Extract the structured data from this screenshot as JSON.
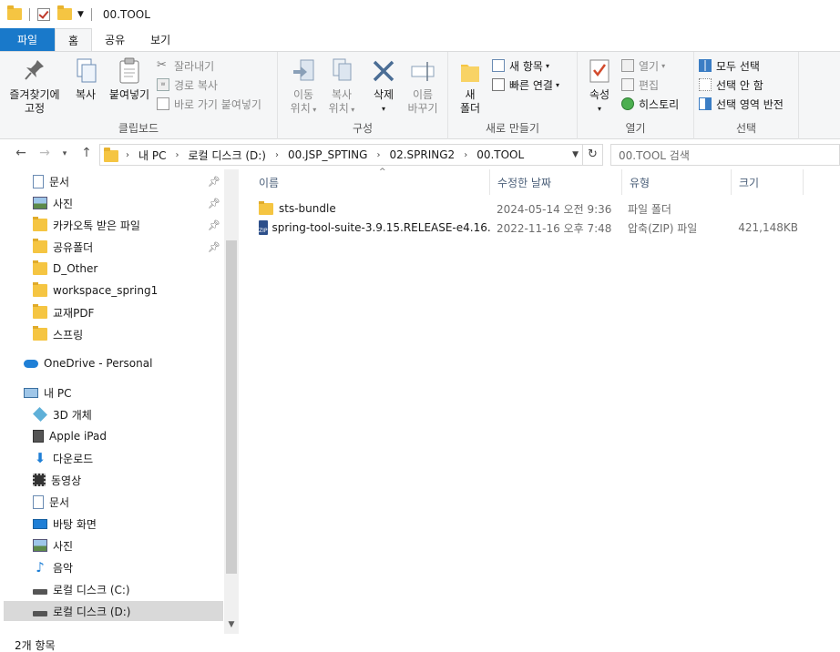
{
  "window": {
    "title": "00.TOOL"
  },
  "ribbon_tabs": [
    {
      "label": "파일"
    },
    {
      "label": "홈"
    },
    {
      "label": "공유"
    },
    {
      "label": "보기"
    }
  ],
  "ribbon": {
    "clipboard": {
      "pin_label_1": "즐겨찾기에",
      "pin_label_2": "고정",
      "copy": "복사",
      "paste": "붙여넣기",
      "cut": "잘라내기",
      "copy_path": "경로 복사",
      "paste_shortcut": "바로 가기 붙여넣기",
      "group": "클립보드"
    },
    "organize": {
      "move_1": "이동",
      "move_2": "위치",
      "copy_1": "복사",
      "copy_2": "위치",
      "delete": "삭제",
      "rename_1": "이름",
      "rename_2": "바꾸기",
      "group": "구성"
    },
    "new": {
      "new_folder_1": "새",
      "new_folder_2": "폴더",
      "new_item": "새 항목",
      "easy_access": "빠른 연결",
      "group": "새로 만들기"
    },
    "open": {
      "properties": "속성",
      "open": "열기",
      "edit": "편집",
      "history": "히스토리",
      "group": "열기"
    },
    "select": {
      "select_all": "모두 선택",
      "select_none": "선택 안 함",
      "invert": "선택 영역 반전",
      "group": "선택"
    }
  },
  "address": {
    "segments": [
      "내 PC",
      "로컬 디스크 (D:)",
      "00.JSP_SPTING",
      "02.SPRING2",
      "00.TOOL"
    ],
    "search_placeholder": "00.TOOL 검색"
  },
  "sidebar": {
    "quick_access": [
      {
        "label": "문서",
        "icon": "document-icon",
        "pinned": true
      },
      {
        "label": "사진",
        "icon": "pictures-icon",
        "pinned": true
      },
      {
        "label": "카카오톡 받은 파일",
        "icon": "folder-icon",
        "pinned": true
      },
      {
        "label": "공유폴더",
        "icon": "shared-folder-icon",
        "pinned": true
      },
      {
        "label": "D_Other",
        "icon": "folder-icon",
        "pinned": false
      },
      {
        "label": "workspace_spring1",
        "icon": "folder-icon",
        "pinned": false
      },
      {
        "label": "교재PDF",
        "icon": "folder-icon",
        "pinned": false
      },
      {
        "label": "스프링",
        "icon": "folder-icon",
        "pinned": false
      }
    ],
    "onedrive": "OneDrive - Personal",
    "this_pc": "내 PC",
    "pc_items": [
      {
        "label": "3D 개체",
        "icon": "3d-objects-icon"
      },
      {
        "label": "Apple iPad",
        "icon": "ipad-icon"
      },
      {
        "label": "다운로드",
        "icon": "download-icon"
      },
      {
        "label": "동영상",
        "icon": "video-icon"
      },
      {
        "label": "문서",
        "icon": "document-icon"
      },
      {
        "label": "바탕 화면",
        "icon": "desktop-icon"
      },
      {
        "label": "사진",
        "icon": "pictures-icon"
      },
      {
        "label": "음악",
        "icon": "music-icon"
      },
      {
        "label": "로컬 디스크 (C:)",
        "icon": "drive-icon"
      },
      {
        "label": "로컬 디스크 (D:)",
        "icon": "drive-icon",
        "selected": true
      }
    ]
  },
  "columns": [
    "이름",
    "수정한 날짜",
    "유형",
    "크기"
  ],
  "files": [
    {
      "name": "sts-bundle",
      "modified": "2024-05-14 오전 9:36",
      "type": "파일 폴더",
      "size": "",
      "icon": "folder-icon"
    },
    {
      "name": "spring-tool-suite-3.9.15.RELEASE-e4.16....",
      "modified": "2022-11-16 오후 7:48",
      "type": "압축(ZIP) 파일",
      "size": "421,148KB",
      "icon": "zip-icon"
    }
  ],
  "status": {
    "count": "2개 항목"
  },
  "colors": {
    "file_tab": "#1979ca",
    "ribbon_bg": "#f5f6f7",
    "folder": "#f5c542",
    "selected": "#d9d9d9"
  }
}
